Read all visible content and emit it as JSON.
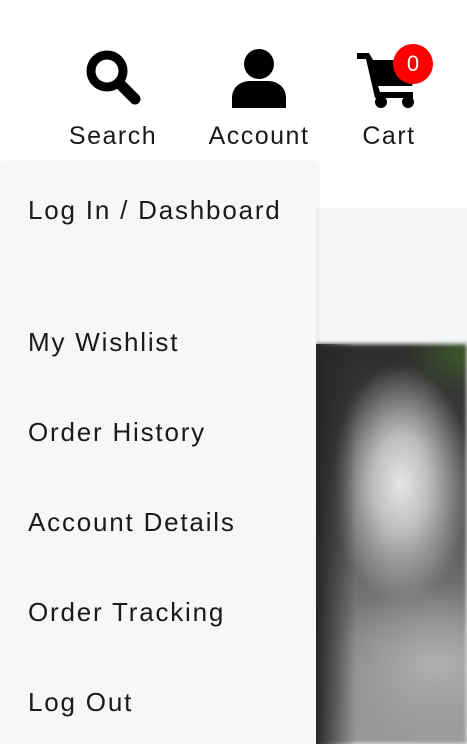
{
  "header": {
    "search": {
      "label": "Search",
      "icon": "search-icon"
    },
    "account": {
      "label": "Account",
      "icon": "user-icon"
    },
    "cart": {
      "label": "Cart",
      "icon": "cart-icon",
      "count": "0"
    }
  },
  "account_menu": {
    "items": [
      {
        "label": "Log In / Dashboard"
      },
      {
        "label": "My Wishlist"
      },
      {
        "label": "Order History"
      },
      {
        "label": "Account Details"
      },
      {
        "label": "Order Tracking"
      },
      {
        "label": "Log Out"
      }
    ]
  },
  "colors": {
    "badge": "#ff0000",
    "icon": "#000000",
    "text": "#1a1a1a",
    "menu_bg": "#f7f7f7"
  }
}
